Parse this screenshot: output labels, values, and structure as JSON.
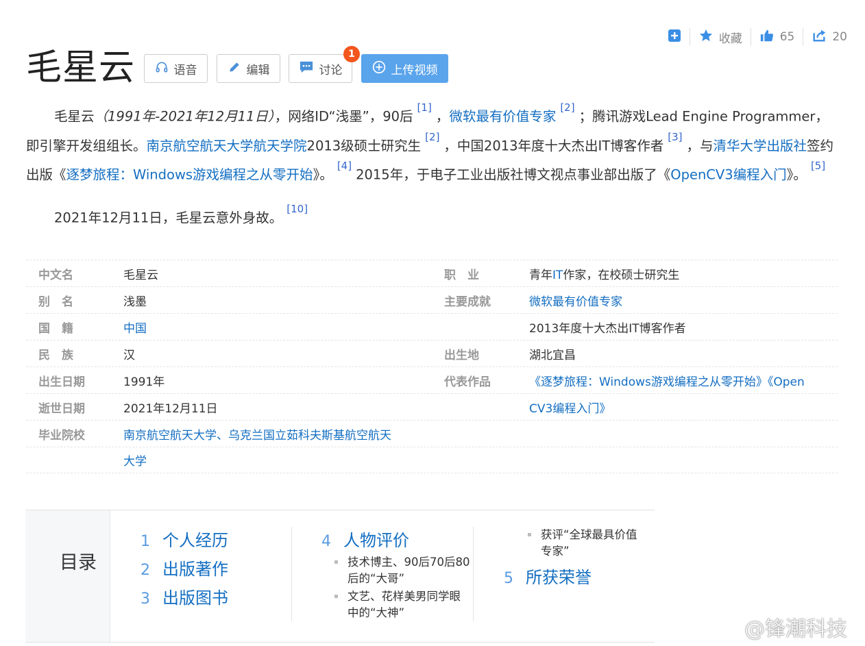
{
  "actions": {
    "add_label": "",
    "collect_label": "收藏",
    "like_count": "65",
    "share_count": "20"
  },
  "title": "毛星云",
  "buttons": {
    "voice": "语音",
    "edit": "编辑",
    "discuss": "讨论",
    "discuss_badge": "1",
    "upload": "上传视频"
  },
  "summary": {
    "p1_name": "毛星云",
    "p1_dates": "（1991年-2021年12月11日）",
    "p1_t1": "，网络ID“浅墨”，90后",
    "ref1": "[1]",
    "p1_t2": "，",
    "link_mvp": "微软最有价值专家",
    "ref2": "[2]",
    "p1_t3": "；腾讯游戏Lead Engine Programmer，即引擎开发组组长。",
    "link_nuaa": "南京航空航天大学航天学院",
    "p1_t4": "2013级硕士研究生",
    "ref2b": "[2]",
    "p1_t5": "，中国2013年度十大杰出IT博客作者",
    "ref3": "[3]",
    "p1_t6": "，与",
    "link_tsinghua": "清华大学出版社",
    "p1_t7": "签约出版《",
    "link_book1": "逐梦旅程：Windows游戏编程之从零开始",
    "p1_t8": "》。",
    "ref4": "[4]",
    "p1_t9": "2015年，于电子工业出版社博文视点事业部出版了《",
    "link_book2": "OpenCV3编程入门",
    "p1_t10": "》。",
    "ref5": "[5]",
    "p2_text": "2021年12月11日，毛星云意外身故。",
    "ref10": "[10]"
  },
  "info": {
    "rows": [
      {
        "k1": "中文名",
        "v1": "毛星云",
        "k2": "职　业",
        "v2": "青年IT作家，在校硕士研究生"
      },
      {
        "k1": "别　名",
        "v1": "浅墨",
        "k2": "主要成就",
        "v2": "微软最有价值专家"
      },
      {
        "k1": "国　籍",
        "v1": "中国",
        "k2": "",
        "v2": "2013年度十大杰出IT博客作者"
      },
      {
        "k1": "民　族",
        "v1": "汉",
        "k2": "出生地",
        "v2": "湖北宜昌"
      },
      {
        "k1": "出生日期",
        "v1": "1991年",
        "k2": "代表作品",
        "v2": "《逐梦旅程：Windows游戏编程之从零开始》《Open"
      },
      {
        "k1": "逝世日期",
        "v1": "2021年12月11日",
        "k2": "",
        "v2": "CV3编程入门》"
      },
      {
        "k1": "毕业院校",
        "v1": "南京航空航天大学、乌克兰国立茹科夫斯基航空航天",
        "k2": "",
        "v2": ""
      },
      {
        "k1": "",
        "v1": "大学",
        "k2": "",
        "v2": ""
      }
    ]
  },
  "toc": {
    "heading": "目录",
    "items": [
      {
        "num": "1",
        "label": "个人经历"
      },
      {
        "num": "2",
        "label": "出版著作"
      },
      {
        "num": "3",
        "label": "出版图书"
      },
      {
        "num": "4",
        "label": "人物评价"
      },
      {
        "num": "5",
        "label": "所获荣誉"
      }
    ],
    "sub4": [
      "技术博主、90后70后80后的“大哥”",
      "文艺、花样美男同学眼中的“大神”"
    ],
    "sub4_last": "获评“全球最具价值专家”"
  },
  "watermark": "@锋潮科技",
  "colors": {
    "link": "#136ec2",
    "upload_button": "#5aa4ec",
    "badge": "#f2561d",
    "label_gray": "#999999"
  }
}
